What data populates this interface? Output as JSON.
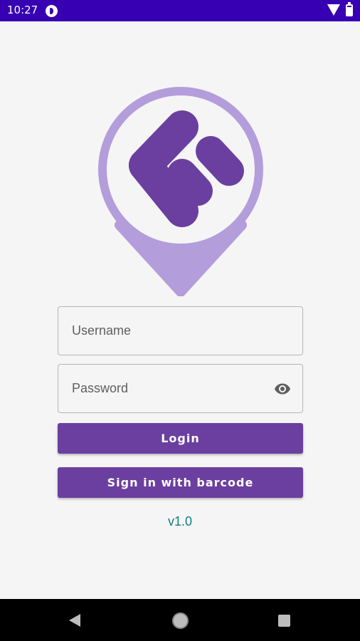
{
  "status_bar": {
    "time": "10:27",
    "icons": [
      "notification-icon",
      "wifi-icon",
      "battery-icon"
    ]
  },
  "login_form": {
    "username": {
      "placeholder": "Username",
      "value": ""
    },
    "password": {
      "placeholder": "Password",
      "value": "",
      "toggle_icon": "eye-icon"
    },
    "login_label": "Login",
    "barcode_label": "Sign in with barcode",
    "version": "v1.0"
  },
  "nav_bar": {
    "icons": [
      "back-icon",
      "home-icon",
      "recents-icon"
    ]
  },
  "colors": {
    "status_bar": "#3700b3",
    "primary": "#6b3fa0",
    "logo_ring": "#b39ddb",
    "logo_mark": "#6b3fa0",
    "version_text": "#137f80",
    "background": "#f5f5f5"
  }
}
